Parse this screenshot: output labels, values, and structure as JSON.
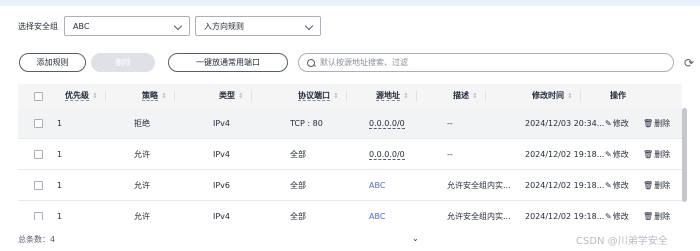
{
  "filter": {
    "group_label": "选择安全组",
    "group_value": "ABC",
    "direction_value": "入方向规则"
  },
  "toolbar": {
    "add_label": "添加规则",
    "delete_label": "删除",
    "allow_common_ports_label": "一键放通常用端口",
    "search_placeholder": "默认按源地址搜索、过滤",
    "refresh_icon": "refresh-icon"
  },
  "table": {
    "headers": {
      "priority": "优先级",
      "policy": "策略",
      "type": "类型",
      "protocol_port": "协议端口",
      "source": "源地址",
      "description": "描述",
      "modified": "修改时间",
      "actions": "操作"
    },
    "action_labels": {
      "edit": "修改",
      "delete": "删除"
    },
    "rows": [
      {
        "priority": "1",
        "policy": "拒绝",
        "type": "IPv4",
        "protocol_port": "TCP : 80",
        "source": "0.0.0.0/0",
        "source_kind": "cidr",
        "description": "--",
        "modified": "2024/12/03 20:34..."
      },
      {
        "priority": "1",
        "policy": "允许",
        "type": "IPv4",
        "protocol_port": "全部",
        "source": "0.0.0.0/0",
        "source_kind": "cidr",
        "description": "--",
        "modified": "2024/12/02 19:18..."
      },
      {
        "priority": "1",
        "policy": "允许",
        "type": "IPv6",
        "protocol_port": "全部",
        "source": "ABC",
        "source_kind": "group",
        "description": "允许安全组内实...",
        "modified": "2024/12/02 19:18..."
      },
      {
        "priority": "1",
        "policy": "允许",
        "type": "IPv4",
        "protocol_port": "全部",
        "source": "ABC",
        "source_kind": "group",
        "description": "允许安全组内实...",
        "modified": "2024/12/02 19:18..."
      }
    ]
  },
  "footer": {
    "total_label": "总条数：4"
  },
  "watermark": "CSDN @川弟学安全",
  "colors": {
    "link": "#526ecc",
    "header_bg": "#f5f5f6",
    "highlight_row": "#f2f3f5"
  }
}
